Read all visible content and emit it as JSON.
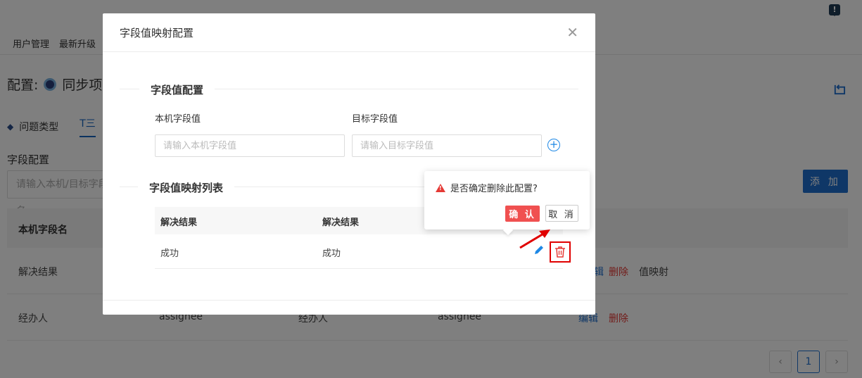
{
  "nav": {
    "items": [
      "用户管理",
      "最新升级"
    ]
  },
  "header": {
    "config_label": "配置:",
    "project_name": "同步项目"
  },
  "tabs": [
    {
      "label": "问题类型"
    },
    {
      "label": "T三"
    }
  ],
  "field_config": {
    "title": "字段配置",
    "search_placeholder": "请输入本机/目标字段名",
    "add_label": "添 加"
  },
  "table": {
    "columns": [
      "本机字段名"
    ],
    "rows": [
      {
        "local": "解决结果",
        "edit": "编辑",
        "delete": "删除",
        "map": "值映射"
      },
      {
        "local": "经办人",
        "c2": "assignee",
        "c3": "经办人",
        "c4": "assignee",
        "edit": "编辑",
        "delete": "删除"
      }
    ]
  },
  "pager": {
    "prev": "‹",
    "current": "1",
    "next": "›"
  },
  "modal": {
    "title": "字段值映射配置",
    "section1": "字段值配置",
    "local_label": "本机字段值",
    "target_label": "目标字段值",
    "local_placeholder": "请输入本机字段值",
    "target_placeholder": "请输入目标字段值",
    "section2": "字段值映射列表",
    "list_columns": [
      "解决结果",
      "解决结果"
    ],
    "list_rows": [
      {
        "local": "成功",
        "target": "成功"
      }
    ]
  },
  "popconfirm": {
    "message": "是否确定删除此配置?",
    "ok": "确 认",
    "cancel": "取 消"
  },
  "colors": {
    "primary": "#1e6fce",
    "danger": "#f05050",
    "highlight": "#e00000"
  }
}
